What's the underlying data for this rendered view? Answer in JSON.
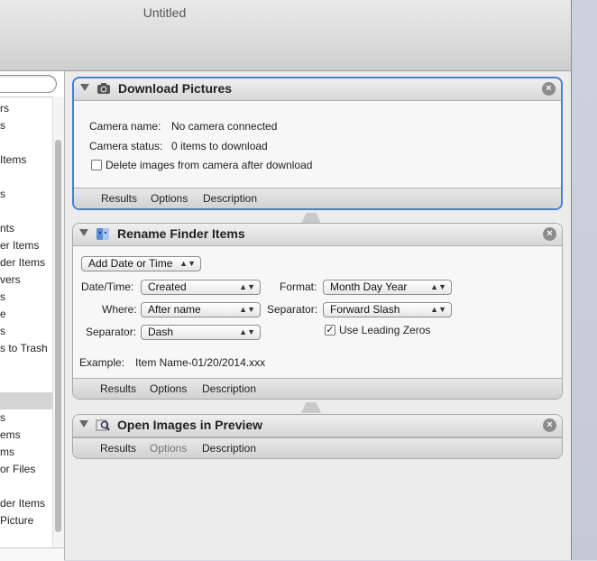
{
  "window": {
    "title": "Untitled"
  },
  "library": {
    "items": [
      {
        "label": "rs"
      },
      {
        "label": "s"
      },
      {
        "label": ""
      },
      {
        "label": "Items"
      },
      {
        "label": ""
      },
      {
        "label": "s"
      },
      {
        "label": ""
      },
      {
        "label": "nts"
      },
      {
        "label": "er Items"
      },
      {
        "label": "der Items"
      },
      {
        "label": "vers"
      },
      {
        "label": "s"
      },
      {
        "label": "e"
      },
      {
        "label": "s"
      },
      {
        "label": "s to Trash"
      },
      {
        "label": ""
      },
      {
        "label": ""
      },
      {
        "label": "s"
      },
      {
        "label": "ems"
      },
      {
        "label": "ms"
      },
      {
        "label": "or Files"
      },
      {
        "label": ""
      },
      {
        "label": "der Items"
      },
      {
        "label": "Picture"
      }
    ]
  },
  "actions": {
    "download": {
      "title": "Download Pictures",
      "camera_name_label": "Camera name:",
      "camera_name_value": "No camera connected",
      "camera_status_label": "Camera status:",
      "camera_status_value": "0 items to download",
      "delete_label": "Delete images from camera after download",
      "footer": {
        "results": "Results",
        "options": "Options",
        "description": "Description"
      }
    },
    "rename": {
      "title": "Rename Finder Items",
      "mode_popup": "Add Date or Time",
      "datetime_label": "Date/Time:",
      "datetime_value": "Created",
      "where_label": "Where:",
      "where_value": "After name",
      "separator_label": "Separator:",
      "separator_value": "Dash",
      "format_label": "Format:",
      "format_value": "Month Day Year",
      "separator2_label": "Separator:",
      "separator2_value": "Forward Slash",
      "leading_zeros_label": "Use Leading Zeros",
      "leading_zeros_checked": true,
      "example_label": "Example:",
      "example_value": "Item Name-01/20/2014.xxx",
      "footer": {
        "results": "Results",
        "options": "Options",
        "description": "Description"
      }
    },
    "preview": {
      "title": "Open Images in Preview",
      "footer": {
        "results": "Results",
        "options": "Options",
        "description": "Description"
      }
    }
  },
  "icons": {
    "popup_arrow": "▲▼",
    "check_mark": "✓",
    "close": "×"
  },
  "colors": {
    "selection_border": "#4a7fd6"
  }
}
